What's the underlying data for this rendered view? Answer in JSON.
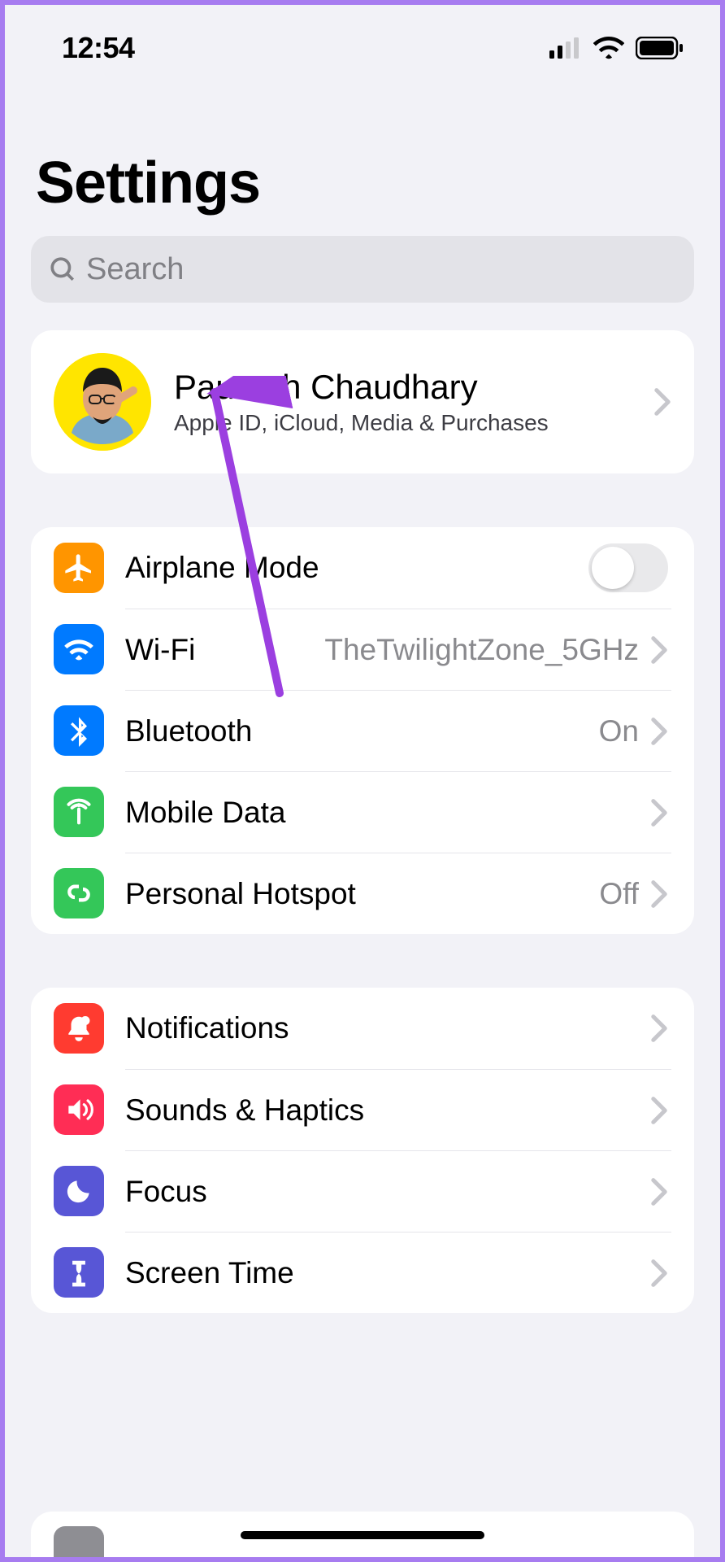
{
  "status": {
    "time": "12:54"
  },
  "title": "Settings",
  "search": {
    "placeholder": "Search"
  },
  "profile": {
    "name": "Paurush Chaudhary",
    "subtitle": "Apple ID, iCloud, Media & Purchases"
  },
  "network": {
    "airplane": {
      "label": "Airplane Mode"
    },
    "wifi": {
      "label": "Wi-Fi",
      "value": "TheTwilightZone_5GHz"
    },
    "bluetooth": {
      "label": "Bluetooth",
      "value": "On"
    },
    "mobile": {
      "label": "Mobile Data"
    },
    "hotspot": {
      "label": "Personal Hotspot",
      "value": "Off"
    }
  },
  "general": {
    "notifications": {
      "label": "Notifications"
    },
    "sounds": {
      "label": "Sounds & Haptics"
    },
    "focus": {
      "label": "Focus"
    },
    "screentime": {
      "label": "Screen Time"
    }
  }
}
